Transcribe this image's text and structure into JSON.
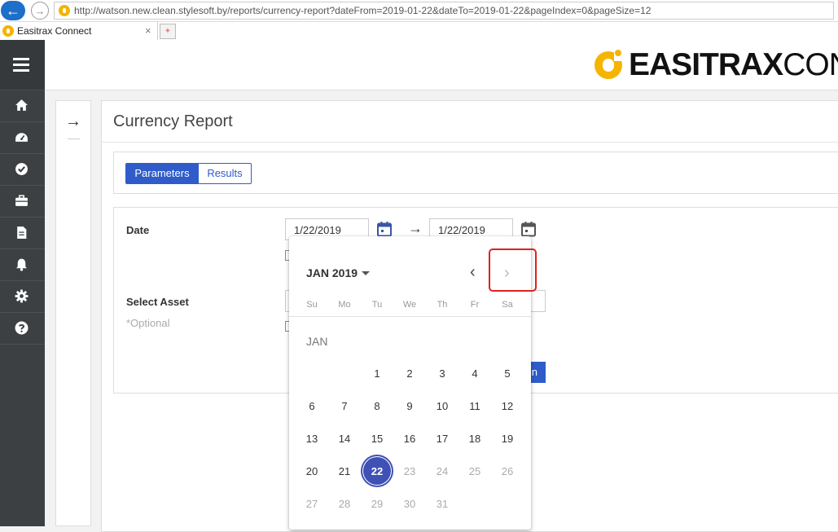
{
  "browser": {
    "url": "http://watson.new.clean.stylesoft.by/reports/currency-report?dateFrom=2019-01-22&dateTo=2019-01-22&pageIndex=0&pageSize=12",
    "tab_title": "Easitrax Connect",
    "tab_close": "×"
  },
  "logo": {
    "bold": "EASITRAX",
    "thin": "CON"
  },
  "sidebar": {
    "items": [
      {
        "icon": "home-icon"
      },
      {
        "icon": "dashboard-icon"
      },
      {
        "icon": "check-circle-icon"
      },
      {
        "icon": "briefcase-icon"
      },
      {
        "icon": "document-icon"
      },
      {
        "icon": "bell-icon"
      },
      {
        "icon": "gear-icon"
      },
      {
        "icon": "help-icon"
      }
    ]
  },
  "page": {
    "title": "Currency Report",
    "tabs": [
      {
        "label": "Parameters",
        "active": true
      },
      {
        "label": "Results",
        "active": false
      }
    ]
  },
  "form": {
    "date_label": "Date",
    "date_from": "1/22/2019",
    "date_to": "1/22/2019",
    "asset_label": "Select Asset",
    "asset_optional": "*Optional",
    "run_button_visible": "n"
  },
  "datepicker": {
    "period": "JAN 2019",
    "weekdays": [
      "Su",
      "Mo",
      "Tu",
      "We",
      "Th",
      "Fr",
      "Sa"
    ],
    "month_label": "JAN",
    "selected_day": "22",
    "weeks": [
      [
        "",
        "",
        "1",
        "2",
        "3",
        "4",
        "5"
      ],
      [
        "6",
        "7",
        "8",
        "9",
        "10",
        "11",
        "12"
      ],
      [
        "13",
        "14",
        "15",
        "16",
        "17",
        "18",
        "19"
      ],
      [
        "20",
        "21",
        "22",
        "23",
        "24",
        "25",
        "26"
      ],
      [
        "27",
        "28",
        "29",
        "30",
        "31",
        "",
        ""
      ]
    ],
    "last_enabled_day": 22
  },
  "colors": {
    "accent": "#2f5cc9",
    "selected_day": "#3f51b5",
    "sidebar": "#3c4043",
    "brand_yellow": "#f5b400",
    "annotation_red": "#e02020"
  }
}
